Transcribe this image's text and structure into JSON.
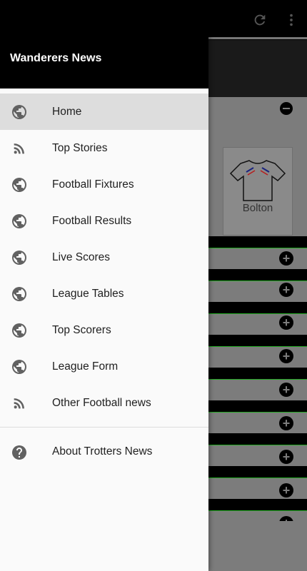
{
  "drawer": {
    "title": "Wanderers News",
    "items": [
      {
        "label": "Home",
        "icon": "globe-icon",
        "active": true
      },
      {
        "label": "Top Stories",
        "icon": "rss-icon"
      },
      {
        "label": "Football Fixtures",
        "icon": "globe-icon"
      },
      {
        "label": "Football Results",
        "icon": "globe-icon"
      },
      {
        "label": "Live Scores",
        "icon": "globe-icon"
      },
      {
        "label": "League Tables",
        "icon": "globe-icon"
      },
      {
        "label": "Top Scorers",
        "icon": "globe-icon"
      },
      {
        "label": "League Form",
        "icon": "globe-icon"
      },
      {
        "label": "Other Football news",
        "icon": "rss-icon"
      }
    ],
    "about": {
      "label": "About Trotters News",
      "icon": "help-icon"
    }
  },
  "background": {
    "team_name": "Bolton",
    "toolbar_icons": [
      "refresh-icon",
      "more-vert-icon"
    ]
  }
}
